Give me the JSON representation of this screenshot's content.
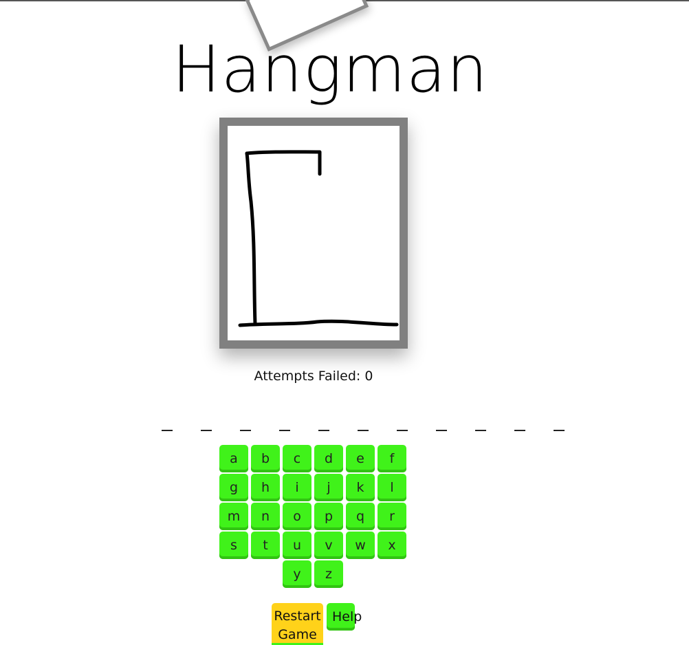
{
  "title": "Hangman",
  "attempts": {
    "label": "Attempts Failed: ",
    "value": "0"
  },
  "word": {
    "slot_count": 11,
    "slots": [
      "_",
      "_",
      "_",
      "_",
      "_",
      "_",
      "_",
      "_",
      "_",
      "_",
      "_"
    ]
  },
  "keyboard": {
    "letters": [
      "a",
      "b",
      "c",
      "d",
      "e",
      "f",
      "g",
      "h",
      "i",
      "j",
      "k",
      "l",
      "m",
      "n",
      "o",
      "p",
      "q",
      "r",
      "s",
      "t",
      "u",
      "v",
      "w",
      "x",
      "y",
      "z"
    ]
  },
  "buttons": {
    "restart_label": "Restart Game",
    "help_label": "Help"
  },
  "colors": {
    "key_green": "#40f21a",
    "restart_yellow": "#ffd21a",
    "frame_gray": "#808080"
  },
  "gallows": {
    "stage": 0
  }
}
